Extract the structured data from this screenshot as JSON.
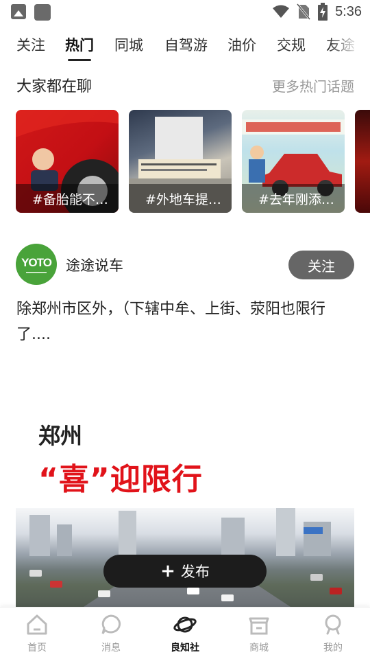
{
  "status_bar": {
    "time": "5:36"
  },
  "tabs": [
    {
      "label": "关注"
    },
    {
      "label": "热门",
      "active": true
    },
    {
      "label": "同城"
    },
    {
      "label": "自驾游"
    },
    {
      "label": "油价"
    },
    {
      "label": "交规"
    },
    {
      "label": "友途"
    }
  ],
  "section": {
    "title": "大家都在聊",
    "more": "更多热门话题"
  },
  "topics": [
    {
      "label": "#备胎能不…"
    },
    {
      "label": "#外地车提…"
    },
    {
      "label": "#去年刚添…"
    }
  ],
  "post": {
    "avatar_text": "YOTO",
    "author": "途途说车",
    "follow_label": "关注",
    "text": "除郑州市区外，（下辖中牟、上街、荥阳也限行了....",
    "image_city": "郑州",
    "image_slogan": "“喜”迎限行"
  },
  "publish": {
    "label": "发布"
  },
  "bottom_nav": [
    {
      "label": "首页"
    },
    {
      "label": "消息"
    },
    {
      "label": "良知社",
      "active": true
    },
    {
      "label": "商城"
    },
    {
      "label": "我的"
    }
  ],
  "colors": {
    "accent_red": "#e1131a",
    "avatar_green": "#49a33a",
    "follow_gray": "#666666"
  }
}
